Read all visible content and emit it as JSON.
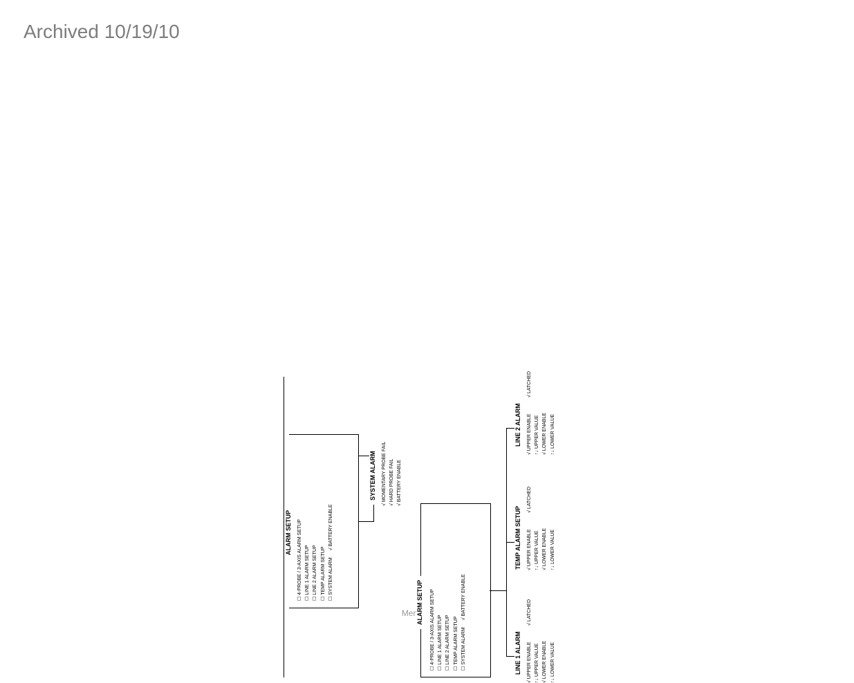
{
  "watermark": "Archived 10/19/10",
  "footer": "Menu System",
  "alarm_setup": {
    "title": "ALARM SETUP",
    "items": [
      "4-PROBE / 3-AXIS ALARM SETUP",
      "LINE 1 ALARM SETUP",
      "LINE 2 ALARM SETUP",
      "TEMP ALARM SETUP",
      "SYSTEM ALARM"
    ],
    "battery": "BATTERY ENABLE"
  },
  "system_alarm": {
    "title": "SYSTEM ALARM",
    "items": [
      "MOMENTARY PROBE FAIL",
      "HARD PROBE FAIL",
      "BATTERY ENABLE"
    ]
  },
  "line1": {
    "title": "LINE 1 ALARM",
    "left": [
      "UPPER ENABLE",
      "UPPER VALUE",
      "LOWER ENABLE",
      "LOWER VALUE"
    ],
    "right": "LATCHED"
  },
  "temp": {
    "title": "TEMP ALARM SETUP",
    "left": [
      "UPPER ENABLE",
      "UPPER VALUE",
      "LOWER ENABLE",
      "LOWER VALUE"
    ],
    "right": "LATCHED"
  },
  "line2": {
    "title": "LINE 2 ALARM",
    "left": [
      "UPPER ENABLE",
      "UPPER VALUE",
      "LOWER ENABLE",
      "LOWER VALUE"
    ],
    "right": "LATCHED"
  }
}
